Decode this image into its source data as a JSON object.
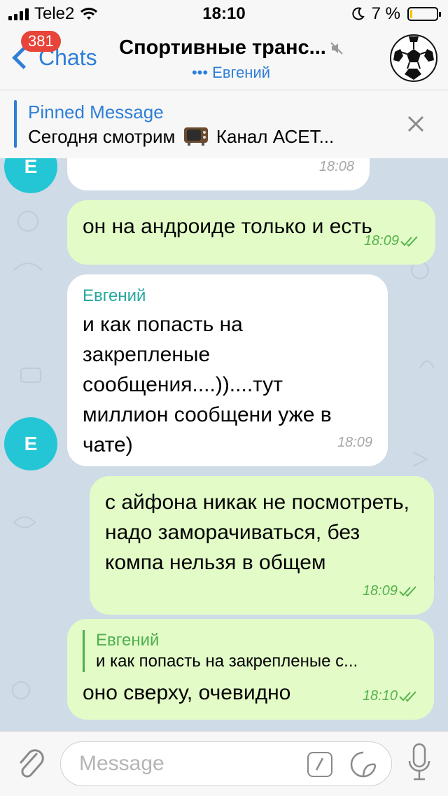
{
  "status": {
    "carrier": "Tele2",
    "time": "18:10",
    "battery_percent": "7 %",
    "battery_level": 0.07,
    "battery_color": "#f2c500"
  },
  "nav": {
    "back_label": "Chats",
    "unread_badge": "381",
    "title": "Спортивные транс...",
    "typing_dots": "•••",
    "subtitle": "Евгений",
    "accent": "#2e7fd8",
    "avatar_icon": "soccer-ball-icon"
  },
  "pinned": {
    "title": "Pinned Message",
    "text_before": "Сегодня смотрим",
    "text_after": "Канал АСЕТ...",
    "emoji_icon": "tv-icon"
  },
  "messages": [
    {
      "direction": "in",
      "time": "18:08",
      "avatar": "E"
    },
    {
      "direction": "out",
      "text": "он на андроиде только и есть",
      "time": "18:09"
    },
    {
      "direction": "in",
      "sender": "Евгений",
      "text": "и как попасть на закрепленые сообщения....))....тут миллион сообщени уже в чате)",
      "time": "18:09",
      "avatar": "E"
    },
    {
      "direction": "out",
      "text": "с айфона никак не посмотреть, надо заморачиваться, без компа нельзя в общем",
      "time": "18:09"
    },
    {
      "direction": "out",
      "reply_name": "Евгений",
      "reply_text": "и как попасть на закрепленые с...",
      "text": "оно сверху, очевидно",
      "time": "18:10"
    }
  ],
  "input": {
    "placeholder": "Message"
  }
}
